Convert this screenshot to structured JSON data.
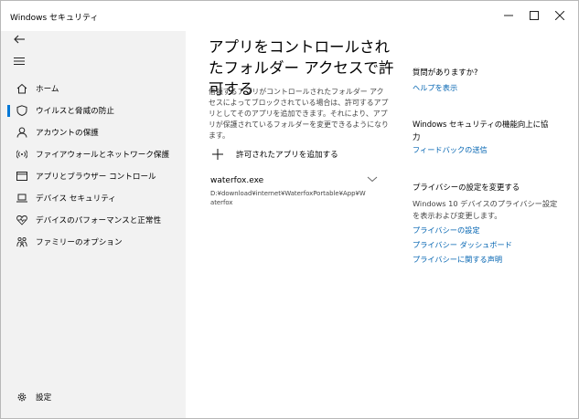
{
  "window": {
    "title": "Windows セキュリティ",
    "controls": {
      "minimize": "—",
      "maximize": "☐",
      "close": "✕"
    }
  },
  "sidebar": {
    "back_icon": "back-arrow-icon",
    "menu_icon": "hamburger-menu-icon",
    "items": [
      {
        "label": "ホーム",
        "icon": "home-icon",
        "active": false
      },
      {
        "label": "ウイルスと脅威の防止",
        "icon": "shield-icon",
        "active": true
      },
      {
        "label": "アカウントの保護",
        "icon": "person-icon",
        "active": false
      },
      {
        "label": "ファイアウォールとネットワーク保護",
        "icon": "wifi-antenna-icon",
        "active": false
      },
      {
        "label": "アプリとブラウザー コントロール",
        "icon": "app-window-icon",
        "active": false
      },
      {
        "label": "デバイス セキュリティ",
        "icon": "laptop-icon",
        "active": false
      },
      {
        "label": "デバイスのパフォーマンスと正常性",
        "icon": "heart-pulse-icon",
        "active": false
      },
      {
        "label": "ファミリーのオプション",
        "icon": "family-icon",
        "active": false
      }
    ],
    "settings_label": "設定",
    "settings_icon": "gear-icon",
    "accent_color": "#0078d7"
  },
  "main": {
    "title": "アプリをコントロールされたフォルダー アクセスで許可する",
    "description": "信頼するアプリがコントロールされたフォルダー アクセスによってブロックされている場合は、許可するアプリとしてそのアプリを追加できます。それにより、アプリが保護されているフォルダーを変更できるようになります。",
    "add_button_label": "許可されたアプリを追加する",
    "allowed_apps": [
      {
        "name": "waterfox.exe",
        "path": "D:¥download¥internet¥WaterfoxPortable¥App¥Waterfox"
      }
    ]
  },
  "right_panel": {
    "question_heading": "質問がありますか?",
    "help_link": "ヘルプを表示",
    "improve_heading": "Windows セキュリティの機能向上に協力",
    "feedback_link": "フィードバックの送信",
    "privacy_heading": "プライバシーの設定を変更する",
    "privacy_text": "Windows 10 デバイスのプライバシー設定を表示および変更します。",
    "privacy_links": [
      "プライバシーの設定",
      "プライバシー ダッシュボード",
      "プライバシーに関する声明"
    ],
    "link_color": "#0063b1"
  }
}
